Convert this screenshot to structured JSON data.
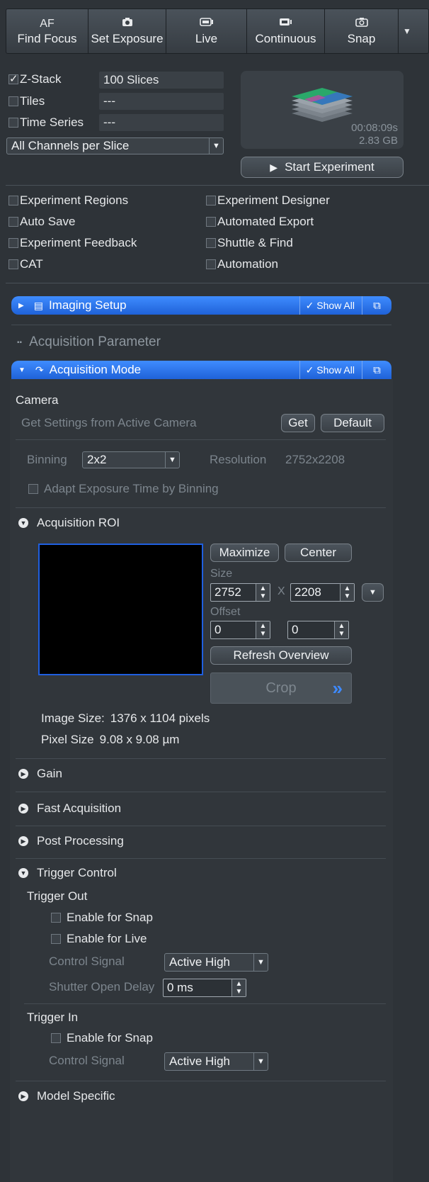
{
  "toolbar": {
    "buttons": [
      {
        "label": "Find Focus",
        "icon": "AF"
      },
      {
        "label": "Set Exposure",
        "icon": "camera-icon"
      },
      {
        "label": "Live",
        "icon": "live-camera-icon"
      },
      {
        "label": "Continuous",
        "icon": "video-camera-icon"
      },
      {
        "label": "Snap",
        "icon": "snap-camera-icon"
      }
    ],
    "af_text": "AF"
  },
  "dimensions": {
    "zstack": {
      "label": "Z-Stack",
      "value": "100 Slices",
      "checked": true
    },
    "tiles": {
      "label": "Tiles",
      "value": "---",
      "checked": false
    },
    "time_series": {
      "label": "Time Series",
      "value": "---",
      "checked": false
    },
    "channels_mode": "All Channels per Slice"
  },
  "preview": {
    "time": "00:08:09s",
    "size": "2.83 GB"
  },
  "start_button": "Start Experiment",
  "options": {
    "left": [
      "Experiment Regions",
      "Auto Save",
      "Experiment Feedback",
      "CAT"
    ],
    "right": [
      "Experiment Designer",
      "Automated Export",
      "Shuttle & Find",
      "Automation"
    ]
  },
  "imaging_setup": {
    "title": "Imaging Setup",
    "show_all": "Show All"
  },
  "acq_param_title": "Acquisition Parameter",
  "acq_mode": {
    "title": "Acquisition Mode",
    "show_all": "Show All"
  },
  "camera": {
    "title": "Camera",
    "get_settings": "Get Settings from Active Camera",
    "get_btn": "Get",
    "default_btn": "Default",
    "binning_label": "Binning",
    "binning_value": "2x2",
    "resolution_label": "Resolution",
    "resolution_value": "2752x2208",
    "adapt_label": "Adapt Exposure Time by Binning"
  },
  "roi": {
    "title": "Acquisition ROI",
    "maximize": "Maximize",
    "center": "Center",
    "size_label": "Size",
    "size_w": "2752",
    "size_x": "X",
    "size_h": "2208",
    "offset_label": "Offset",
    "offset_x": "0",
    "offset_y": "0",
    "refresh": "Refresh Overview",
    "crop": "Crop",
    "image_size_label": "Image Size:",
    "image_size_value": "1376 x 1104 pixels",
    "pixel_size_label": "Pixel Size",
    "pixel_size_value": "9.08 x 9.08 µm"
  },
  "sections": {
    "gain": "Gain",
    "fast_acq": "Fast Acquisition",
    "post_proc": "Post Processing",
    "trigger": "Trigger Control",
    "model": "Model Specific"
  },
  "trigger": {
    "out_title": "Trigger Out",
    "enable_snap": "Enable for Snap",
    "enable_live": "Enable for Live",
    "control_signal": "Control Signal",
    "active_high": "Active High",
    "shutter_delay": "Shutter Open Delay",
    "delay_value": "0 ms",
    "in_title": "Trigger In",
    "in_enable_snap": "Enable for Snap",
    "in_control_signal": "Control Signal",
    "in_active_high": "Active High"
  }
}
